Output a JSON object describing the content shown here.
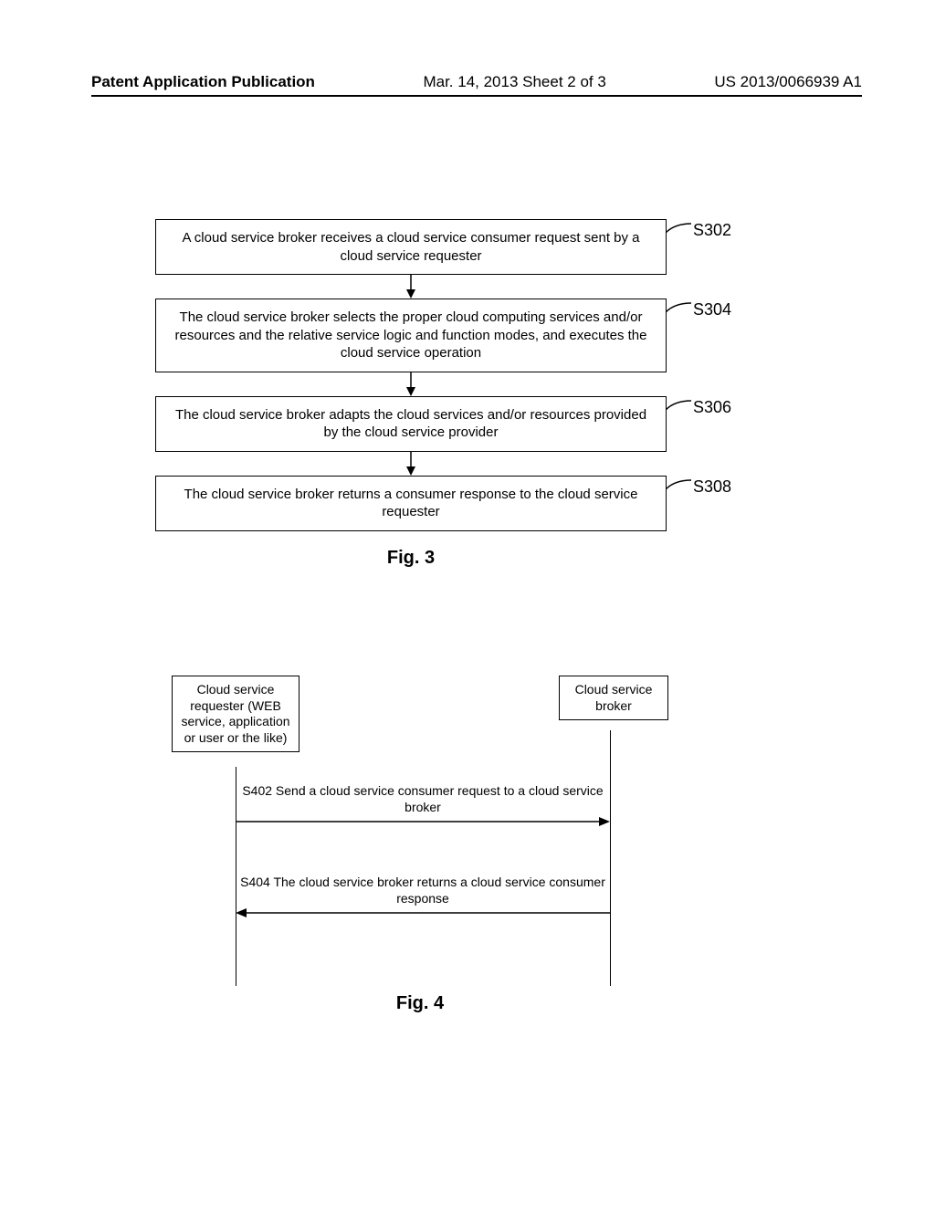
{
  "header": {
    "left": "Patent Application Publication",
    "center": "Mar. 14, 2013  Sheet 2 of 3",
    "right": "US 2013/0066939 A1"
  },
  "fig3": {
    "steps": [
      {
        "id": "S302",
        "text": "A cloud service broker receives a cloud service consumer request sent by a cloud service requester"
      },
      {
        "id": "S304",
        "text": "The cloud service broker selects the proper cloud computing services and/or resources and the relative service logic and function modes, and executes the cloud service operation"
      },
      {
        "id": "S306",
        "text": "The cloud service broker adapts the cloud services and/or resources provided by the cloud service provider"
      },
      {
        "id": "S308",
        "text": "The cloud service broker returns a consumer response to the cloud service requester"
      }
    ],
    "caption": "Fig. 3"
  },
  "fig4": {
    "participants": {
      "left": "Cloud service requester (WEB service, application or user or the like)",
      "right": "Cloud service broker"
    },
    "messages": [
      {
        "id": "S402",
        "text": "S402 Send a cloud service consumer request to a cloud service broker",
        "dir": "right"
      },
      {
        "id": "S404",
        "text": "S404 The cloud service broker returns a cloud service consumer response",
        "dir": "left"
      }
    ],
    "caption": "Fig. 4"
  }
}
